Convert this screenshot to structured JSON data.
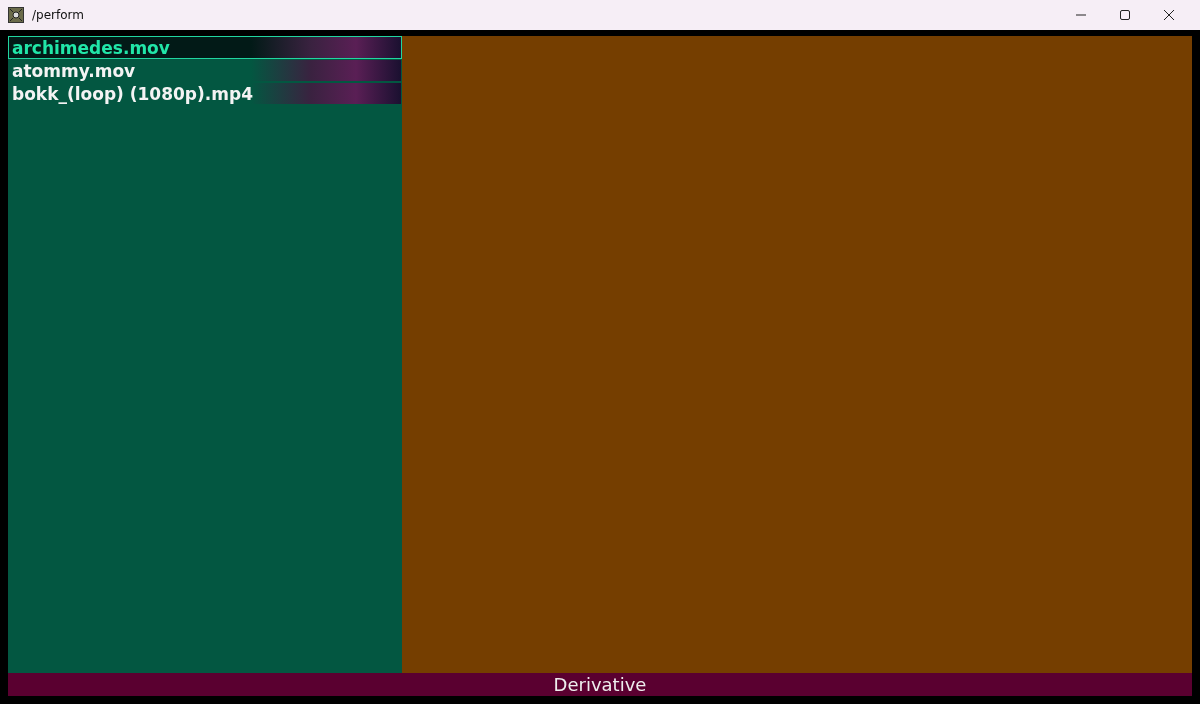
{
  "window": {
    "title": "/perform"
  },
  "files": [
    {
      "name": "archimedes.mov",
      "selected": true
    },
    {
      "name": "atommy.mov",
      "selected": false
    },
    {
      "name": "bokk_(loop) (1080p).mp4",
      "selected": false
    }
  ],
  "status_bar": {
    "label": "Derivative"
  }
}
